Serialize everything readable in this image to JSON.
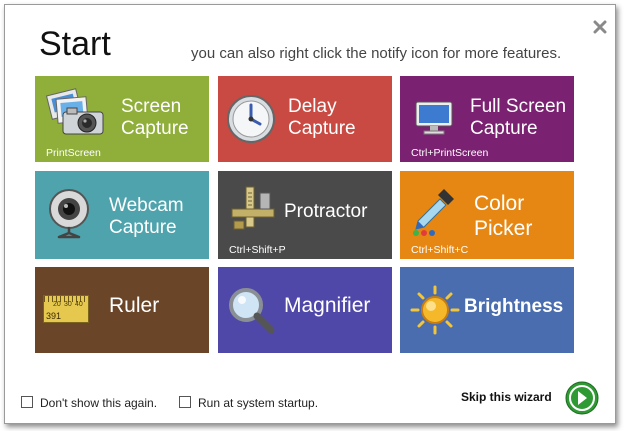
{
  "header": {
    "title": "Start",
    "subtitle": "you can also right click the notify icon for more features."
  },
  "tiles": [
    {
      "label": "Screen\nCapture",
      "shortcut": "PrintScreen",
      "color": "#8fae3a",
      "icon": "photos-camera-icon"
    },
    {
      "label": "Delay\nCapture",
      "shortcut": "",
      "color": "#c94a42",
      "icon": "clock-icon"
    },
    {
      "label": "Full Screen\nCapture",
      "shortcut": "Ctrl+PrintScreen",
      "color": "#7b2171",
      "icon": "monitor-icon"
    },
    {
      "label": "Webcam\nCapture",
      "shortcut": "",
      "color": "#4fa3ad",
      "icon": "webcam-icon"
    },
    {
      "label": "Protractor",
      "shortcut": "Ctrl+Shift+P",
      "color": "#4a4a4a",
      "icon": "caliper-icon"
    },
    {
      "label": "Color\nPicker",
      "shortcut": "Ctrl+Shift+C",
      "color": "#e68713",
      "icon": "eyedropper-icon"
    },
    {
      "label": "Ruler",
      "shortcut": "",
      "color": "#6b4528",
      "icon": "ruler-icon",
      "ruler_ticks": [
        "20",
        "30",
        "40"
      ],
      "ruler_value": "391"
    },
    {
      "label": "Magnifier",
      "shortcut": "",
      "color": "#4f48a8",
      "icon": "magnifier-icon"
    },
    {
      "label": "Brightness",
      "shortcut": "",
      "color": "#4a6db0",
      "icon": "sun-icon"
    }
  ],
  "footer": {
    "dont_show": "Don't show this again.",
    "startup": "Run at system startup.",
    "skip": "Skip this wizard"
  }
}
